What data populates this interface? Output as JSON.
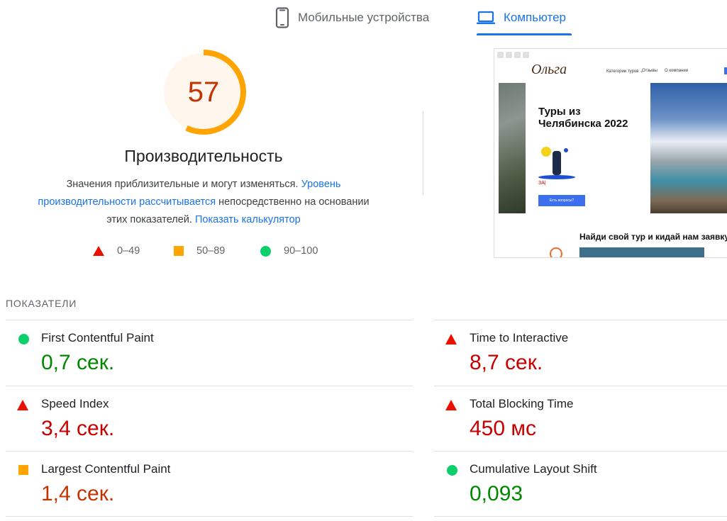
{
  "tabs": [
    {
      "label": "Мобильные устройства",
      "active": false,
      "icon": "smartphone-icon"
    },
    {
      "label": "Компьютер",
      "active": true,
      "icon": "laptop-icon"
    }
  ],
  "score": {
    "value": 57,
    "fraction": 0.57,
    "color": "#ffa400",
    "background": "#fff7ed",
    "text_color": "#c33300"
  },
  "performance": {
    "title": "Производительность",
    "desc_part1": "Значения приблизительные и могут изменяться. ",
    "desc_link1": "Уровень производительности рассчитывается",
    "desc_part2": " непосредственно на основании этих показателей. ",
    "desc_link2": "Показать калькулятор"
  },
  "legend": [
    {
      "range": "0–49",
      "shape": "triangle",
      "color": "#eb0f00"
    },
    {
      "range": "50–89",
      "shape": "square",
      "color": "#ffa400"
    },
    {
      "range": "90–100",
      "shape": "circle",
      "color": "#0cce6b"
    }
  ],
  "preview": {
    "logo": "Ольга",
    "nav": [
      "Категории туров ⌄",
      "Отзывы",
      "О компании"
    ],
    "hero_title_line1": "Туры из",
    "hero_title_line2": "Челябинска 2022",
    "hero_red_text": "ЗА|",
    "hero_button": "Есть вопросы?",
    "section_title": "Найди свой тур и кидай нам заявку"
  },
  "metrics_header": "ПОКАЗАТЕЛИ",
  "metrics": {
    "fcp": {
      "label": "First Contentful Paint",
      "value": "0,7 сек.",
      "status": "good"
    },
    "tti": {
      "label": "Time to Interactive",
      "value": "8,7 сек.",
      "status": "poor"
    },
    "si": {
      "label": "Speed Index",
      "value": "3,4 сек.",
      "status": "poor"
    },
    "tbt": {
      "label": "Total Blocking Time",
      "value": "450 мс",
      "status": "poor"
    },
    "lcp": {
      "label": "Largest Contentful Paint",
      "value": "1,4 сек.",
      "status": "average"
    },
    "cls": {
      "label": "Cumulative Layout Shift",
      "value": "0,093",
      "status": "good"
    }
  }
}
